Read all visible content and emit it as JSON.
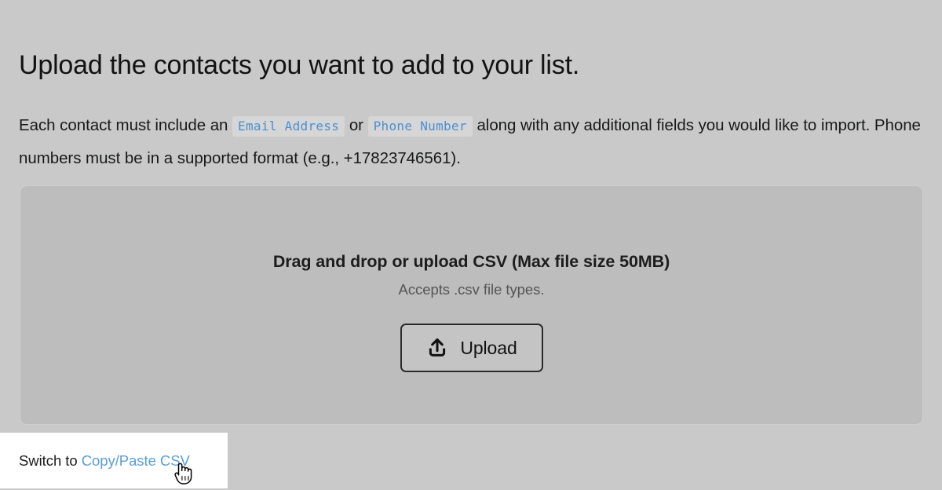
{
  "heading": "Upload the contacts you want to add to your list.",
  "intro": {
    "before_first_chip": "Each contact must include an ",
    "chip_email": "Email Address",
    "between_chips": " or ",
    "chip_phone": "Phone Number",
    "after_chips": " along with any additional fields you would like to import. Phone numbers must be in a supported format (e.g., +17823746561)."
  },
  "dropzone": {
    "title": "Drag and drop or upload CSV (Max file size 50MB)",
    "subtitle": "Accepts .csv file types.",
    "upload_button_label": "Upload",
    "upload_icon": "upload-arrow-icon"
  },
  "switch_panel": {
    "prefix": "Switch to ",
    "link_label": "Copy/Paste CSV"
  },
  "cursor": {
    "type": "pointer-hand-cursor"
  },
  "colors": {
    "page_background": "#c9c9c9",
    "dropzone_fill": "#bdbdbd",
    "dropzone_border": "#cfcfcf",
    "code_chip_text": "#4a8fd0",
    "code_chip_background": "#d6d6d6",
    "link": "#5a9ed6",
    "button_border": "#2b2b2b",
    "panel_background": "#ffffff",
    "heading_text": "#121212",
    "body_text": "#18191a",
    "muted_text": "#555555"
  }
}
